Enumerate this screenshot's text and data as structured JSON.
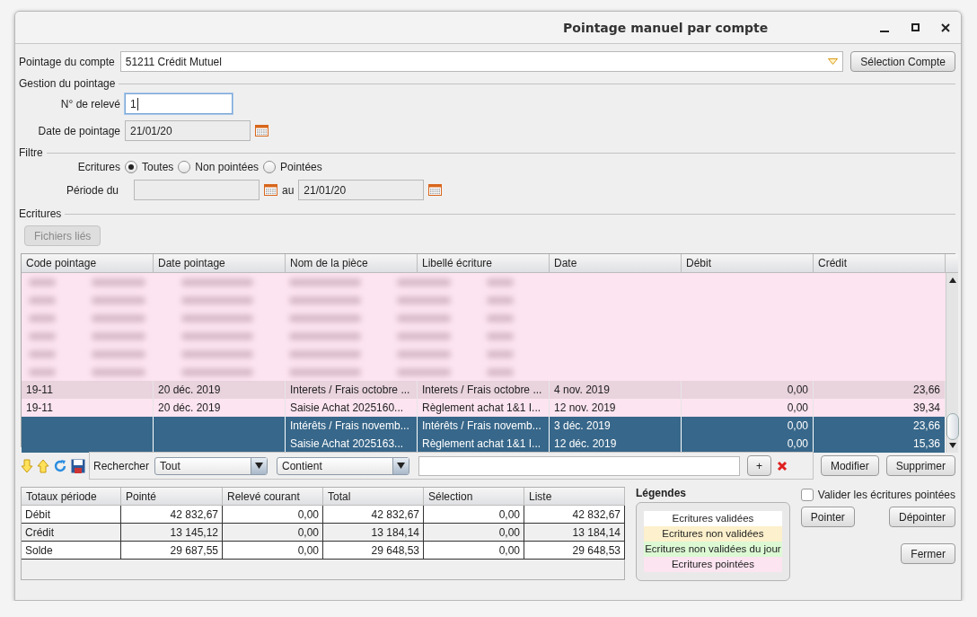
{
  "window": {
    "title": "Pointage manuel par compte"
  },
  "account": {
    "label": "Pointage du compte",
    "value": "51211 Crédit Mutuel",
    "button": "Sélection Compte"
  },
  "gestion": {
    "title": "Gestion du pointage",
    "releve_label": "N° de relevé",
    "releve_value": "1",
    "date_label": "Date de pointage",
    "date_value": "21/01/20"
  },
  "filtre": {
    "title": "Filtre",
    "ecritures_label": "Ecritures",
    "options": [
      {
        "label": "Toutes",
        "selected": true
      },
      {
        "label": "Non pointées",
        "selected": false
      },
      {
        "label": "Pointées",
        "selected": false
      }
    ],
    "periode_label": "Période du",
    "au_label": "au",
    "to_value": "21/01/20"
  },
  "ecritures": {
    "title": "Ecritures",
    "files_button": {
      "label": "Fichiers liés",
      "disabled": true
    },
    "columns": [
      "Code pointage",
      "Date pointage",
      "Nom de la pièce",
      "Libellé écriture",
      "Date",
      "Débit",
      "Crédit"
    ],
    "rows": [
      {
        "kind": "blurred",
        "color": "#fce4f0"
      },
      {
        "kind": "blurred",
        "color": "#fce4f0"
      },
      {
        "kind": "blurred",
        "color": "#fce4f0"
      },
      {
        "kind": "blurred",
        "color": "#fce4f0"
      },
      {
        "kind": "blurred",
        "color": "#fce4f0"
      },
      {
        "kind": "blurred",
        "color": "#fce4f0"
      },
      {
        "kind": "entry",
        "selected": false,
        "color": "#e9d3dd",
        "cells": [
          "19-11",
          "20 déc. 2019",
          "Interets / Frais octobre ...",
          "Interets / Frais octobre ...",
          "4 nov. 2019",
          "0,00",
          "23,66"
        ]
      },
      {
        "kind": "entry",
        "selected": false,
        "color": "#fce4f0",
        "cells": [
          "19-11",
          "20 déc. 2019",
          "Saisie Achat 2025160...",
          "Règlement achat 1&1 I...",
          "12 nov. 2019",
          "0,00",
          "39,34"
        ]
      },
      {
        "kind": "entry",
        "selected": true,
        "cells": [
          "",
          "",
          "Intérêts / Frais novemb...",
          "Intérêts / Frais novemb...",
          "3 déc. 2019",
          "0,00",
          "23,66"
        ]
      },
      {
        "kind": "entry",
        "selected": true,
        "cells": [
          "",
          "",
          "Saisie Achat 2025163...",
          "Règlement achat 1&1 I...",
          "12 déc. 2019",
          "0,00",
          "15,36"
        ]
      }
    ]
  },
  "search": {
    "label": "Rechercher",
    "scope": "Tout",
    "mode": "Contient",
    "add": "+",
    "buttons": [
      "Modifier",
      "Supprimer"
    ]
  },
  "totals": {
    "columns": [
      "Totaux période",
      "Pointé",
      "Relevé courant",
      "Total",
      "Sélection",
      "Liste"
    ],
    "rows": [
      [
        "Débit",
        "42 832,67",
        "0,00",
        "42 832,67",
        "0,00",
        "42 832,67"
      ],
      [
        "Crédit",
        "13 145,12",
        "0,00",
        "13 184,14",
        "0,00",
        "13 184,14"
      ],
      [
        "Solde",
        "29 687,55",
        "0,00",
        "29 648,53",
        "0,00",
        "29 648,53"
      ]
    ]
  },
  "legend": {
    "title": "Légendes",
    "items": [
      {
        "label": "Ecritures validées",
        "color": "#ffffff"
      },
      {
        "label": "Ecritures non validées",
        "color": "#fdf0cc"
      },
      {
        "label": "Ecritures non validées du jour",
        "color": "#dcf9d4"
      },
      {
        "label": "Ecritures pointées",
        "color": "#fce4f0"
      }
    ]
  },
  "validate": {
    "label": "Valider les écritures pointées",
    "checked": false
  },
  "actions": [
    "Pointer",
    "Dépointer",
    "Fermer"
  ]
}
